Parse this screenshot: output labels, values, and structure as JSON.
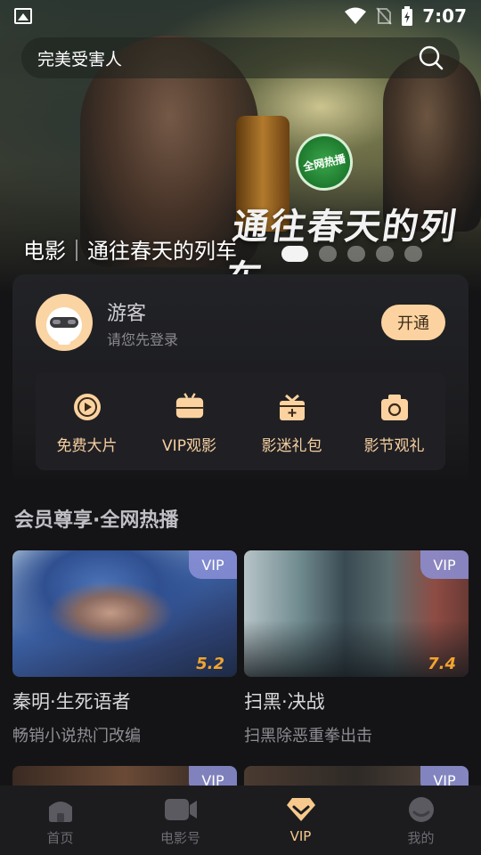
{
  "status_bar": {
    "time": "7:07"
  },
  "search": {
    "text": "完美受害人"
  },
  "banner": {
    "caption": "电影｜通往春天的列车",
    "calligraphy": "通往春天的列车",
    "badge": "全网热播",
    "dots_total": 5,
    "active_dot": 1
  },
  "user": {
    "name": "游客",
    "hint": "请您先登录",
    "open_button": "开通"
  },
  "features": [
    {
      "label": "免费大片",
      "icon": "play-icon"
    },
    {
      "label": "VIP观影",
      "icon": "tv-icon"
    },
    {
      "label": "影迷礼包",
      "icon": "gift-icon"
    },
    {
      "label": "影节观礼",
      "icon": "camera-icon"
    }
  ],
  "section": {
    "title": "会员尊享·全网热播"
  },
  "movies": [
    {
      "title": "秦明·生死语者",
      "desc": "畅销小说热门改编",
      "vip": "VIP",
      "score": "5.2"
    },
    {
      "title": "扫黑·决战",
      "desc": "扫黑除恶重拳出击",
      "vip": "VIP",
      "score": "7.4"
    },
    {
      "vip": "VIP"
    },
    {
      "vip": "VIP"
    }
  ],
  "nav": [
    {
      "label": "首页",
      "icon": "home-icon"
    },
    {
      "label": "电影号",
      "icon": "video-icon"
    },
    {
      "label": "VIP",
      "icon": "vip-diamond-icon"
    },
    {
      "label": "我的",
      "icon": "profile-icon"
    }
  ],
  "colors": {
    "accent": "#fcd3a0",
    "feature_label": "#f6cfa0",
    "score": "#f2a42e",
    "vip_tag": "#8c91d7",
    "background": "#141416"
  }
}
